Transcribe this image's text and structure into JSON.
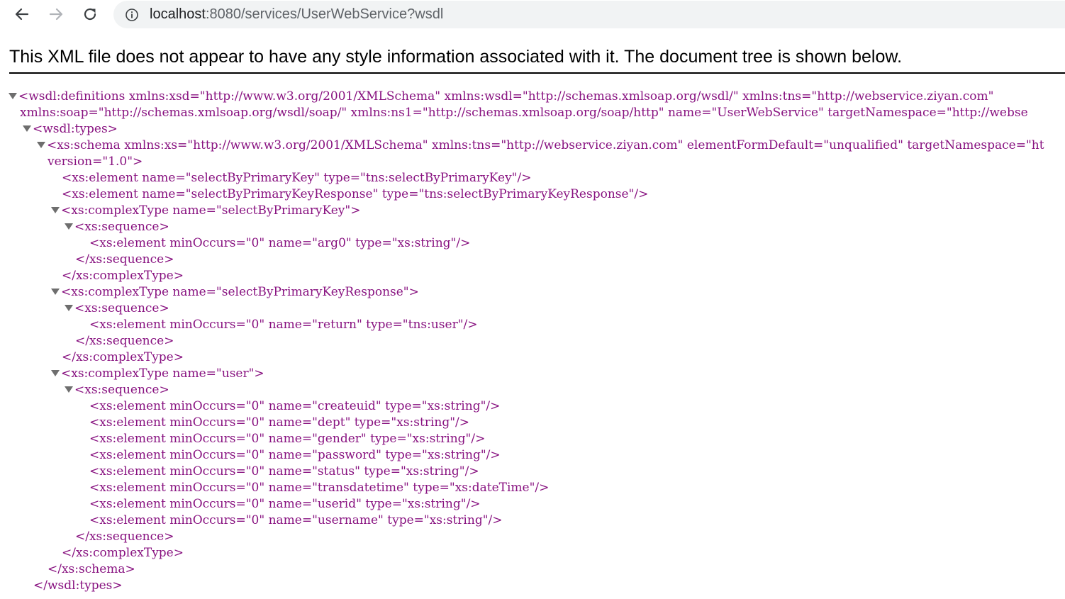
{
  "browser": {
    "url_host": "localhost",
    "url_rest": ":8080/services/UserWebService?wsdl"
  },
  "notice": "This XML file does not appear to have any style information associated with it. The document tree is shown below.",
  "xml_lines": [
    {
      "indent": 12,
      "toggle": true,
      "text": "<wsdl:definitions xmlns:xsd=\"http://www.w3.org/2001/XMLSchema\" xmlns:wsdl=\"http://schemas.xmlsoap.org/wsdl/\" xmlns:tns=\"http://webservice.ziyan.com\""
    },
    {
      "indent": 28,
      "toggle": false,
      "text": "xmlns:soap=\"http://schemas.xmlsoap.org/wsdl/soap/\" xmlns:ns1=\"http://schemas.xmlsoap.org/soap/http\" name=\"UserWebService\" targetNamespace=\"http://webse"
    },
    {
      "indent": 32,
      "toggle": true,
      "text": "<wsdl:types>"
    },
    {
      "indent": 52,
      "toggle": true,
      "text": "<xs:schema xmlns:xs=\"http://www.w3.org/2001/XMLSchema\" xmlns:tns=\"http://webservice.ziyan.com\" elementFormDefault=\"unqualified\" targetNamespace=\"ht"
    },
    {
      "indent": 67,
      "toggle": false,
      "text": "version=\"1.0\">"
    },
    {
      "indent": 87,
      "toggle": false,
      "text": "<xs:element name=\"selectByPrimaryKey\" type=\"tns:selectByPrimaryKey\"/>"
    },
    {
      "indent": 87,
      "toggle": false,
      "text": "<xs:element name=\"selectByPrimaryKeyResponse\" type=\"tns:selectByPrimaryKeyResponse\"/>"
    },
    {
      "indent": 72,
      "toggle": true,
      "text": "<xs:complexType name=\"selectByPrimaryKey\">"
    },
    {
      "indent": 91,
      "toggle": true,
      "text": "<xs:sequence>"
    },
    {
      "indent": 126,
      "toggle": false,
      "text": "<xs:element minOccurs=\"0\" name=\"arg0\" type=\"xs:string\"/>"
    },
    {
      "indent": 106,
      "toggle": false,
      "text": "</xs:sequence>"
    },
    {
      "indent": 87,
      "toggle": false,
      "text": "</xs:complexType>"
    },
    {
      "indent": 72,
      "toggle": true,
      "text": "<xs:complexType name=\"selectByPrimaryKeyResponse\">"
    },
    {
      "indent": 91,
      "toggle": true,
      "text": "<xs:sequence>"
    },
    {
      "indent": 126,
      "toggle": false,
      "text": "<xs:element minOccurs=\"0\" name=\"return\" type=\"tns:user\"/>"
    },
    {
      "indent": 106,
      "toggle": false,
      "text": "</xs:sequence>"
    },
    {
      "indent": 87,
      "toggle": false,
      "text": "</xs:complexType>"
    },
    {
      "indent": 72,
      "toggle": true,
      "text": "<xs:complexType name=\"user\">"
    },
    {
      "indent": 91,
      "toggle": true,
      "text": "<xs:sequence>"
    },
    {
      "indent": 126,
      "toggle": false,
      "text": "<xs:element minOccurs=\"0\" name=\"createuid\" type=\"xs:string\"/>"
    },
    {
      "indent": 126,
      "toggle": false,
      "text": "<xs:element minOccurs=\"0\" name=\"dept\" type=\"xs:string\"/>"
    },
    {
      "indent": 126,
      "toggle": false,
      "text": "<xs:element minOccurs=\"0\" name=\"gender\" type=\"xs:string\"/>"
    },
    {
      "indent": 126,
      "toggle": false,
      "text": "<xs:element minOccurs=\"0\" name=\"password\" type=\"xs:string\"/>"
    },
    {
      "indent": 126,
      "toggle": false,
      "text": "<xs:element minOccurs=\"0\" name=\"status\" type=\"xs:string\"/>"
    },
    {
      "indent": 126,
      "toggle": false,
      "text": "<xs:element minOccurs=\"0\" name=\"transdatetime\" type=\"xs:dateTime\"/>"
    },
    {
      "indent": 126,
      "toggle": false,
      "text": "<xs:element minOccurs=\"0\" name=\"userid\" type=\"xs:string\"/>"
    },
    {
      "indent": 126,
      "toggle": false,
      "text": "<xs:element minOccurs=\"0\" name=\"username\" type=\"xs:string\"/>"
    },
    {
      "indent": 106,
      "toggle": false,
      "text": "</xs:sequence>"
    },
    {
      "indent": 87,
      "toggle": false,
      "text": "</xs:complexType>"
    },
    {
      "indent": 67,
      "toggle": false,
      "text": "</xs:schema>"
    },
    {
      "indent": 47,
      "toggle": false,
      "text": "</wsdl:types>"
    }
  ]
}
